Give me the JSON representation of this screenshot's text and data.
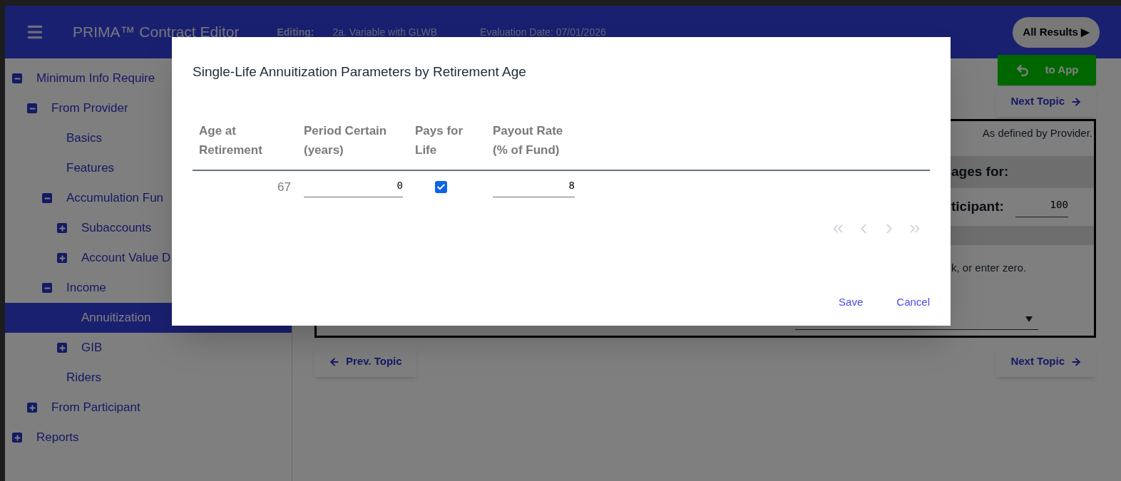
{
  "app_header": {
    "title": "PRIMA™ Contract Editor",
    "editing_label": "Editing:",
    "editing_value": "2a. Variable with GLWB",
    "evaluation_date": "Evaluation Date: 07/01/2026",
    "all_results_button": "All Results ▶",
    "to_app_button": "to App"
  },
  "sidebar": {
    "items": [
      {
        "label": "Minimum Info Require",
        "expanded": true,
        "selected": false,
        "children": [
          {
            "label": "From Provider",
            "expanded": true,
            "selected": false,
            "children": [
              {
                "label": "Basics",
                "selected": false
              },
              {
                "label": "Features",
                "selected": false
              },
              {
                "label": "Accumulation Fun",
                "expanded": true,
                "selected": false,
                "children": [
                  {
                    "label": "Subaccounts",
                    "expanded": false,
                    "selected": false
                  },
                  {
                    "label": "Account Value D",
                    "expanded": false,
                    "selected": false
                  }
                ]
              },
              {
                "label": "Income",
                "expanded": true,
                "selected": false,
                "children": [
                  {
                    "label": "Annuitization",
                    "selected": true
                  },
                  {
                    "label": "GIB",
                    "expanded": false,
                    "selected": false
                  }
                ]
              },
              {
                "label": "Riders",
                "selected": false
              }
            ]
          },
          {
            "label": "From Participant",
            "expanded": false,
            "selected": false
          }
        ]
      },
      {
        "label": "Reports",
        "expanded": false,
        "selected": false
      }
    ]
  },
  "topic_nav": {
    "next_top": "Next Topic",
    "prev": "Prev. Topic",
    "next_bottom": "Next Topic"
  },
  "content": {
    "note": "As defined by Provider.",
    "section_heading": "ages for:",
    "participant_label": "ticipant:",
    "participant_value": "100",
    "instruction": "k, or enter zero."
  },
  "dialog": {
    "title": "Single-Life Annuitization Parameters by Retirement Age",
    "columns": [
      "Age at Retirement",
      "Period Certain (years)",
      "Pays for Life",
      "Payout Rate (% of Fund)"
    ],
    "rows": [
      {
        "age": "67",
        "period_certain": "0",
        "pays_for_life": true,
        "payout_rate": "8"
      }
    ],
    "pagination": {
      "disabled": true
    },
    "buttons": [
      "Save",
      "Cancel"
    ]
  }
}
